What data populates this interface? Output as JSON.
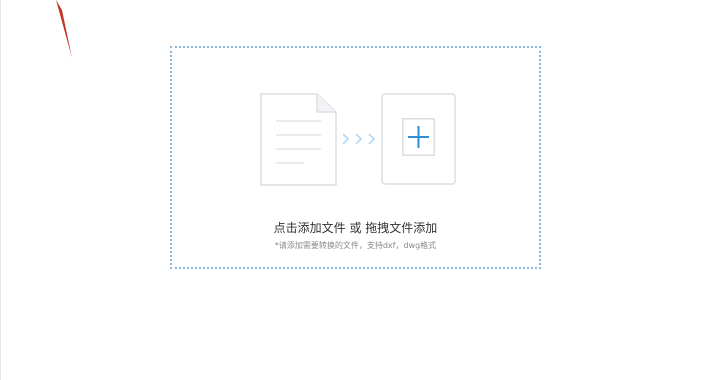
{
  "upload_area": {
    "main_text": "点击添加文件 或 拖拽文件添加",
    "sub_text": "*请添加需要转换的文件，支持dxf，dwg格式"
  },
  "colors": {
    "border": "#8ab8de",
    "arrow": "#a9d6f2",
    "plus": "#2d8fd5",
    "icon_outline": "#dcdde2",
    "annotation": "#c0392b"
  },
  "icons": [
    "document-icon",
    "arrows-icon",
    "add-file-icon"
  ]
}
